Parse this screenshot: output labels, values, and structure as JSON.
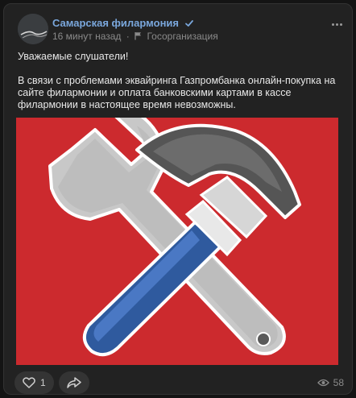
{
  "post": {
    "author": "Самарская филармония",
    "time": "16 минут назад",
    "separator": "·",
    "category": "Госорганизация",
    "paragraphs": [
      "Уважаемые слушатели!",
      "В связи с проблемами эквайринга Газпромбанка онлайн-покупка на сайте филармонии и оплата банковскими картами в кассе филармонии в настоящее время невозможны."
    ],
    "image_background": "#cc2a2e"
  },
  "actions": {
    "likes": "1",
    "views": "58"
  },
  "icons": {
    "verified": "verified-check-icon",
    "category": "flag-icon",
    "like": "heart-icon",
    "share": "share-arrow-icon",
    "views": "eye-icon",
    "more": "more-dots-icon"
  },
  "colors": {
    "author_link": "#7aa7dc",
    "card_bg": "#222222"
  }
}
